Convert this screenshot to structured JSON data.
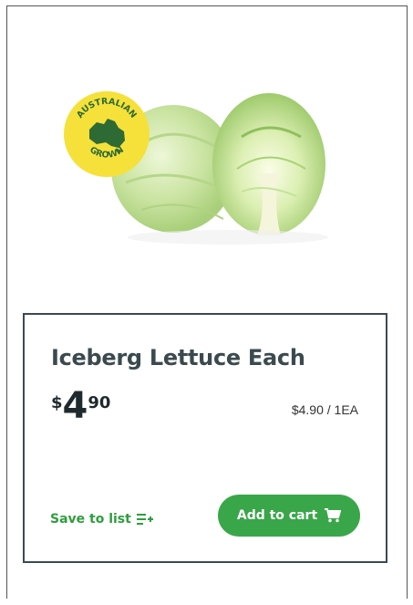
{
  "badge": {
    "top_text": "AUSTRALIAN",
    "bottom_text": "GROWN",
    "color": "#f6e13a",
    "map_color": "#2d6a34"
  },
  "product": {
    "name": "Iceberg Lettuce Each",
    "price": {
      "currency": "$",
      "dollars": "4",
      "cents": "90"
    },
    "unit_price": "$4.90 / 1EA"
  },
  "actions": {
    "save_label": "Save to list",
    "add_label": "Add to cart"
  },
  "colors": {
    "accent": "#3aa64a",
    "card_border": "#3c4a4f",
    "title": "#3b4a4f"
  },
  "icons": {
    "list": "list-add-icon",
    "cart": "cart-icon"
  }
}
